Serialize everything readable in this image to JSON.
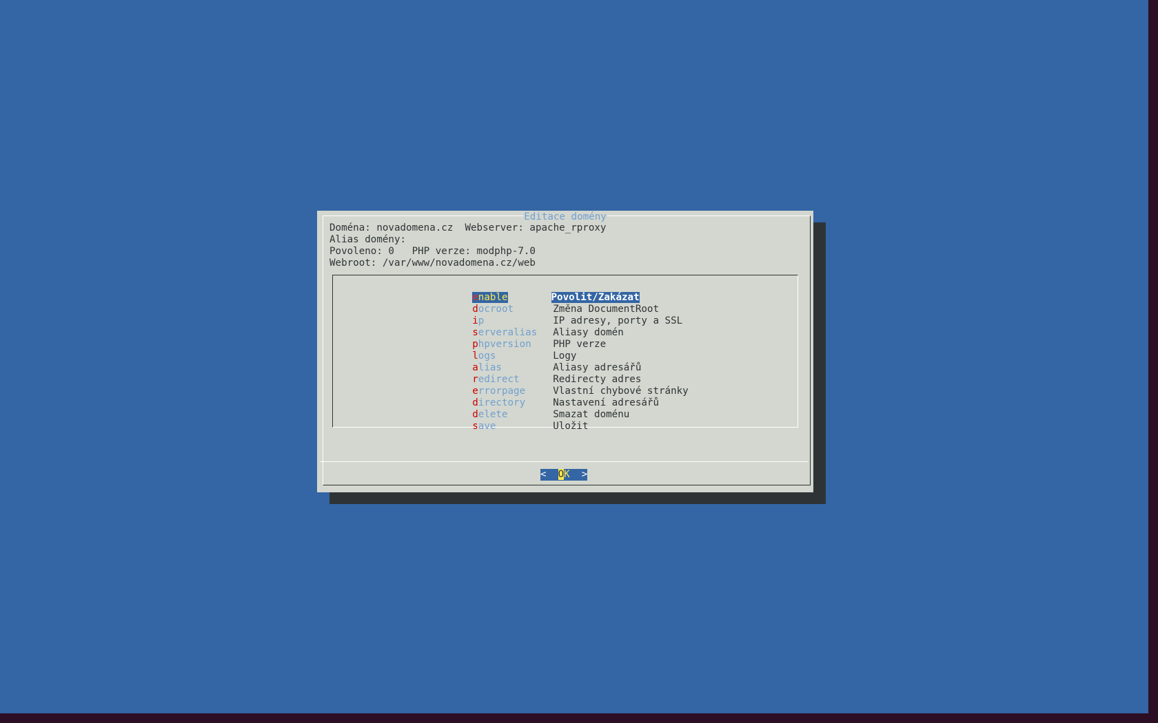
{
  "dialog": {
    "title": "Editace domény",
    "info": {
      "line1": "Doména: novadomena.cz  Webserver: apache_rproxy",
      "line2": "Alias domény:",
      "line3": "Povoleno: 0   PHP verze: modphp-7.0",
      "line4": "Webroot: /var/www/novadomena.cz/web"
    },
    "menu": [
      {
        "hotkey": "e",
        "rest": "nable",
        "desc": "Povolit/Zakázat"
      },
      {
        "hotkey": "d",
        "rest": "ocroot",
        "desc": "Změna DocumentRoot"
      },
      {
        "hotkey": "i",
        "rest": "p",
        "desc": "IP adresy, porty a SSL"
      },
      {
        "hotkey": "s",
        "rest": "erveralias",
        "desc": "Aliasy domén"
      },
      {
        "hotkey": "p",
        "rest": "hpversion",
        "desc": "PHP verze"
      },
      {
        "hotkey": "l",
        "rest": "ogs",
        "desc": "Logy"
      },
      {
        "hotkey": "a",
        "rest": "lias",
        "desc": "Aliasy adresářů"
      },
      {
        "hotkey": "r",
        "rest": "edirect",
        "desc": "Redirecty adres"
      },
      {
        "hotkey": "e",
        "rest": "rrorpage",
        "desc": "Vlastní chybové stránky"
      },
      {
        "hotkey": "d",
        "rest": "irectory",
        "desc": "Nastavení adresářů"
      },
      {
        "hotkey": "d",
        "rest": "elete",
        "desc": "Smazat doménu"
      },
      {
        "hotkey": "s",
        "rest": "ave",
        "desc": "Uložit"
      }
    ],
    "selected_index": 0,
    "button": {
      "left": "<  ",
      "hotkey": "O",
      "rest": "K",
      "right": "  >"
    }
  },
  "colors": {
    "background": "#3465a4",
    "dialog": "#d3d7cf",
    "shadow": "#2e3436",
    "tag": "#729fcf",
    "hotkey": "#cc0000",
    "highlight_fg": "#fce94f"
  }
}
